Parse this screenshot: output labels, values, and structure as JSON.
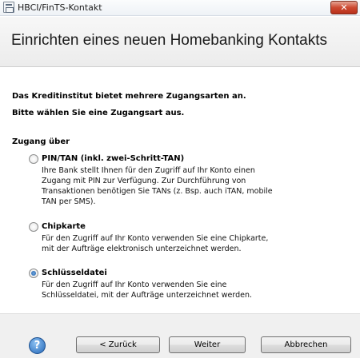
{
  "window": {
    "title": "HBCI/FinTS-Kontakt",
    "close_label": "✕"
  },
  "header": {
    "title": "Einrichten eines neuen Homebanking Kontakts"
  },
  "content": {
    "intro_line1": "Das Kreditinstitut bietet mehrere Zugangsarten an.",
    "intro_line2": "Bitte wählen Sie eine Zugangsart aus.",
    "group_label": "Zugang über",
    "options": [
      {
        "label": "PIN/TAN (inkl. zwei-Schritt-TAN)",
        "checked": false,
        "description": [
          "Ihre Bank stellt Ihnen für den Zugriff auf Ihr Konto einen",
          "Zugang mit PIN zur Verfügung. Zur Durchführung von",
          "Transaktionen benötigen Sie TANs (z. Bsp. auch iTAN, mobile",
          "TAN per SMS)."
        ]
      },
      {
        "label": "Chipkarte",
        "checked": false,
        "description": [
          "Für den Zugriff auf Ihr Konto verwenden Sie eine Chipkarte,",
          "mit der Aufträge elektronisch unterzeichnet werden."
        ]
      },
      {
        "label": "Schlüsseldatei",
        "checked": true,
        "description": [
          "Für den Zugriff auf Ihr Konto verwenden Sie eine",
          "Schlüsseldatei, mit der Aufträge unterzeichnet werden."
        ]
      }
    ]
  },
  "footer": {
    "help_icon_label": "?",
    "back_label": "< Zurück",
    "next_label": "Weiter",
    "cancel_label": "Abbrechen"
  }
}
